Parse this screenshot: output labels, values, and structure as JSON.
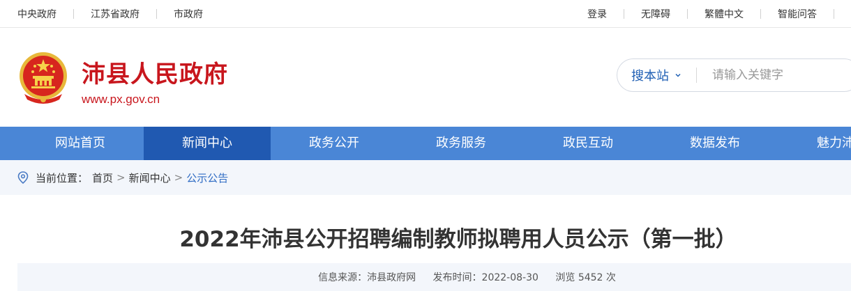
{
  "topbar": {
    "left_links": [
      "中央政府",
      "江苏省政府",
      "市政府"
    ],
    "right_links": [
      "登录",
      "无障碍",
      "繁體中文",
      "智能问答"
    ]
  },
  "header": {
    "site_title": "沛县人民政府",
    "site_url": "www.px.gov.cn"
  },
  "search": {
    "scope_label": "搜本站",
    "placeholder": "请输入关键字"
  },
  "nav": {
    "items": [
      "网站首页",
      "新闻中心",
      "政务公开",
      "政务服务",
      "政民互动",
      "数据发布",
      "魅力沛县"
    ],
    "active_index": 1
  },
  "breadcrumb": {
    "prefix": "当前位置：",
    "items": [
      "首页",
      "新闻中心",
      "公示公告"
    ],
    "separator": ">"
  },
  "article": {
    "title": "2022年沛县公开招聘编制教师拟聘用人员公示（第一批）",
    "source": "信息来源：沛县政府网",
    "publish_time": "发布时间：2022-08-30",
    "views": "浏览 5452 次"
  },
  "colors": {
    "brand_red": "#c8161d",
    "nav_blue": "#4a86d6",
    "nav_active": "#2059b1",
    "link_blue": "#2f6cc4"
  }
}
